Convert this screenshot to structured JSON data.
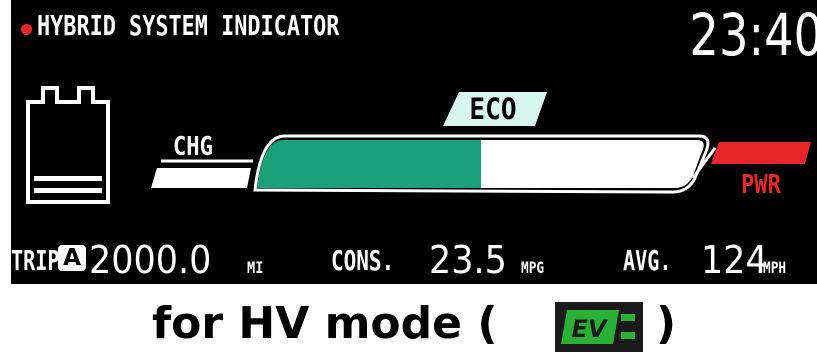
{
  "display": {
    "title": "HYBRID SYSTEM INDICATOR",
    "clock": "23:40",
    "eco_label": "ECO",
    "chg_label": "CHG",
    "pwr_label": "PWR",
    "power_gauge": {
      "eco_zone_fraction": 0.5,
      "charge_zone_fill": "white",
      "colors": {
        "eco_fill": "#1aa17a",
        "white_fill": "#ffffff",
        "power_fill": "#e8252a",
        "accent_red": "#e8252a"
      }
    },
    "battery_icon": "battery-icon",
    "bottom": {
      "trip_label": "TRIP",
      "trip_badge": "A",
      "trip_value": "2000.0",
      "trip_unit": "MI",
      "cons_label": "CONS.",
      "cons_value": "23.5",
      "cons_unit": "MPG",
      "avg_label": "AVG.",
      "avg_value": "124",
      "avg_unit": "MPH"
    }
  },
  "caption": {
    "prefix": "for HV mode (",
    "icon": "ev-mode-icon",
    "icon_text": "EV",
    "suffix": ")",
    "icon_color": "#2ab034"
  }
}
